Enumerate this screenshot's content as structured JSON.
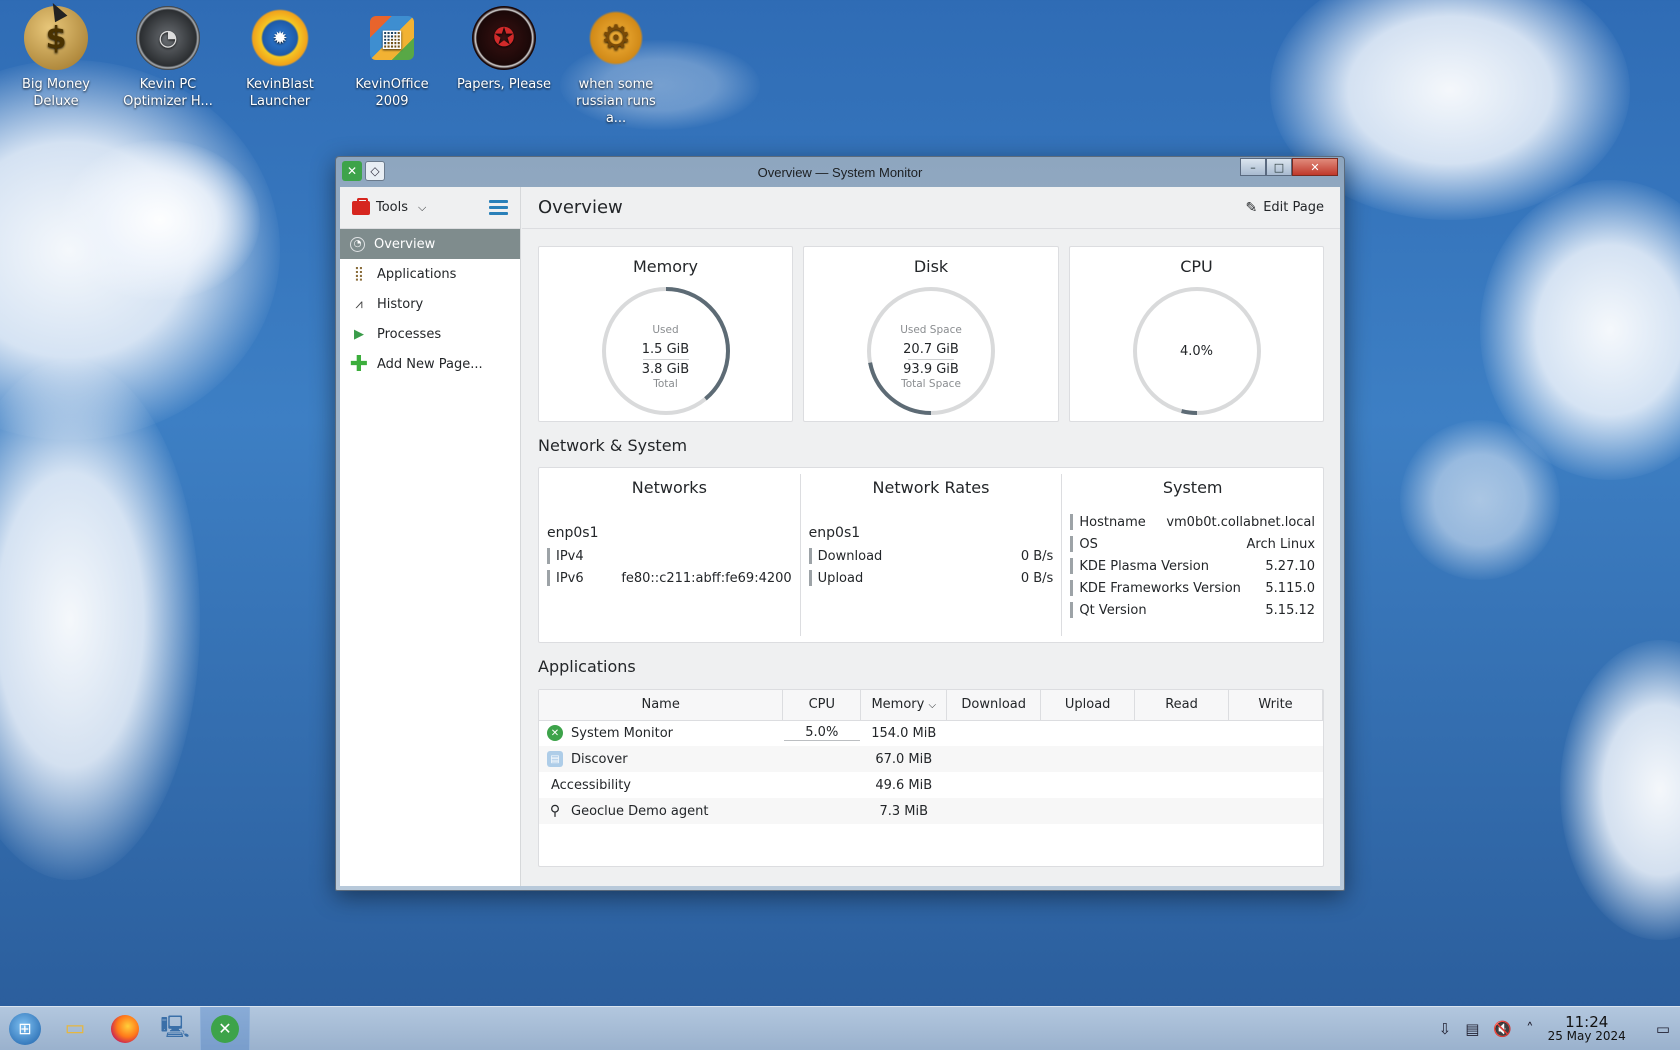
{
  "desktop": {
    "icons": [
      {
        "label": "Big Money Deluxe",
        "icon": "money-bag-icon"
      },
      {
        "label": "Kevin PC Optimizer H...",
        "icon": "speedometer-icon"
      },
      {
        "label": "KevinBlast Launcher",
        "icon": "sun-globe-icon"
      },
      {
        "label": "KevinOffice 2009",
        "icon": "office-icon"
      },
      {
        "label": "Papers, Please",
        "icon": "stamp-icon"
      },
      {
        "label": "when some russian runs a...",
        "icon": "gear-icon"
      }
    ]
  },
  "window": {
    "title": "Overview — System Monitor",
    "controls": {
      "minimize": "–",
      "maximize": "□",
      "close": "✕"
    }
  },
  "sidebar": {
    "tools_label": "Tools",
    "items": [
      {
        "label": "Overview",
        "icon": "overview-icon",
        "active": true
      },
      {
        "label": "Applications",
        "icon": "applications-icon"
      },
      {
        "label": "History",
        "icon": "history-icon"
      },
      {
        "label": "Processes",
        "icon": "processes-icon"
      },
      {
        "label": "Add New Page...",
        "icon": "add-icon"
      }
    ]
  },
  "main": {
    "page_title": "Overview",
    "edit_page_label": "Edit Page",
    "memory": {
      "title": "Memory",
      "top_caption": "Used",
      "top_value": "1.5 GiB",
      "bottom_value": "3.8 GiB",
      "bottom_caption": "Total",
      "fraction": 0.39
    },
    "disk": {
      "title": "Disk",
      "top_caption": "Used Space",
      "top_value": "20.7 GiB",
      "bottom_value": "93.9 GiB",
      "bottom_caption": "Total Space",
      "fraction": 0.22
    },
    "cpu": {
      "title": "CPU",
      "value": "4.0%",
      "fraction": 0.04
    },
    "network_section_title": "Network & System",
    "networks": {
      "title": "Networks",
      "interface": "enp0s1",
      "rows": [
        {
          "k": "IPv4",
          "v": ""
        },
        {
          "k": "IPv6",
          "v": "fe80::c211:abff:fe69:4200"
        }
      ]
    },
    "network_rates": {
      "title": "Network Rates",
      "interface": "enp0s1",
      "rows": [
        {
          "k": "Download",
          "v": "0 B/s"
        },
        {
          "k": "Upload",
          "v": "0 B/s"
        }
      ]
    },
    "system": {
      "title": "System",
      "rows": [
        {
          "k": "Hostname",
          "v": "vm0b0t.collabnet.local"
        },
        {
          "k": "OS",
          "v": "Arch Linux"
        },
        {
          "k": "KDE Plasma Version",
          "v": "5.27.10"
        },
        {
          "k": "KDE Frameworks Version",
          "v": "5.115.0"
        },
        {
          "k": "Qt Version",
          "v": "5.15.12"
        }
      ]
    },
    "applications_section_title": "Applications",
    "table": {
      "headers": [
        "Name",
        "CPU",
        "Memory",
        "Download",
        "Upload",
        "Read",
        "Write"
      ],
      "rows": [
        {
          "name": "System Monitor",
          "cpu": "5.0%",
          "memory": "154.0 MiB",
          "icon": "system-monitor-icon"
        },
        {
          "name": "Discover",
          "cpu": "",
          "memory": "67.0 MiB",
          "icon": "discover-icon"
        },
        {
          "name": "Accessibility",
          "cpu": "",
          "memory": "49.6 MiB",
          "icon": ""
        },
        {
          "name": "Geoclue Demo agent",
          "cpu": "",
          "memory": "7.3 MiB",
          "icon": "location-pin-icon"
        }
      ]
    }
  },
  "taskbar": {
    "items": [
      {
        "icon": "start-orb-icon"
      },
      {
        "icon": "file-manager-icon"
      },
      {
        "icon": "firefox-icon"
      },
      {
        "icon": "desktop-icon"
      },
      {
        "icon": "system-monitor-icon",
        "active": true
      }
    ],
    "clock": {
      "time": "11:24",
      "date": "25 May 2024"
    }
  },
  "colors": {
    "accent": "#2980b9",
    "gauge_track": "#d9dadb",
    "gauge_fill": "#5d6b75",
    "wallpaper": "#2f6cb5"
  }
}
